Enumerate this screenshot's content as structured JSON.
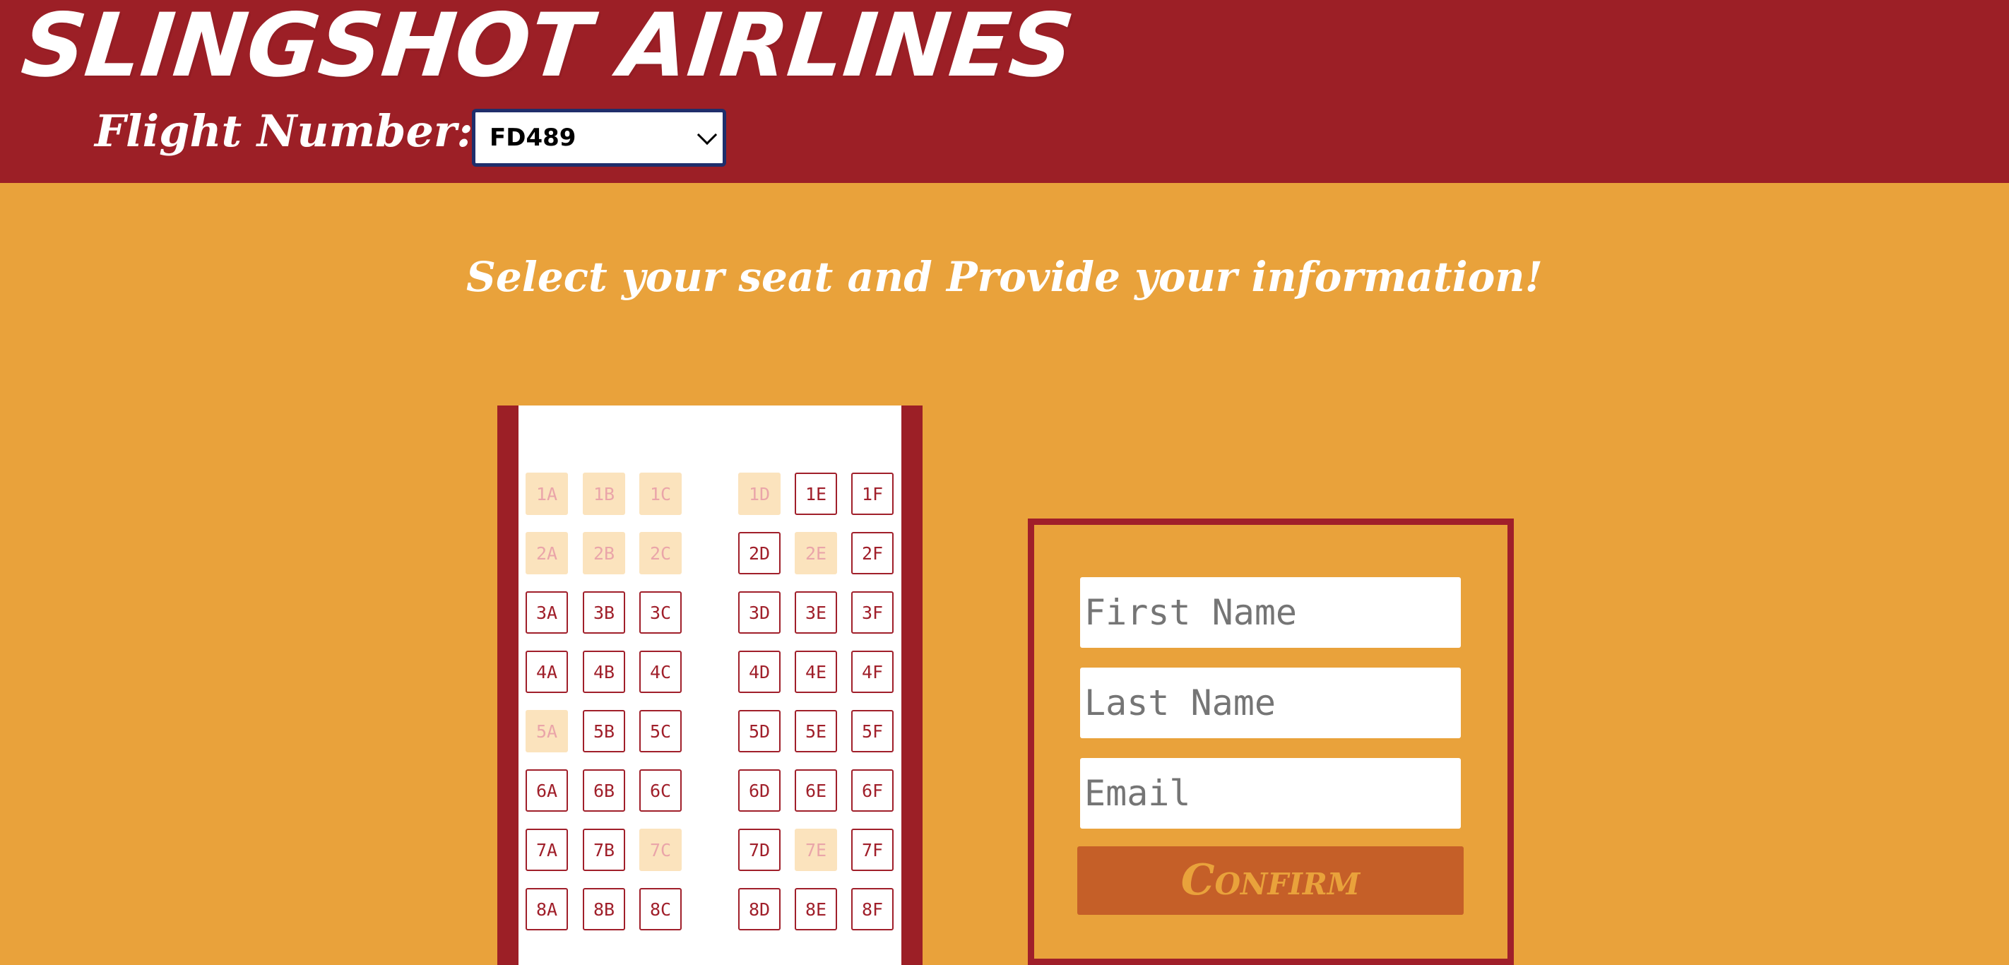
{
  "header": {
    "brand": "Slingshot Airlines",
    "flight_label": "Flight Number:",
    "flight_value": "FD489"
  },
  "prompt": "Select your seat and Provide your information!",
  "seats": [
    {
      "id": "1A",
      "taken": true
    },
    {
      "id": "1B",
      "taken": true
    },
    {
      "id": "1C",
      "taken": true
    },
    {
      "id": "1D",
      "taken": true
    },
    {
      "id": "1E",
      "taken": false
    },
    {
      "id": "1F",
      "taken": false
    },
    {
      "id": "2A",
      "taken": true
    },
    {
      "id": "2B",
      "taken": true
    },
    {
      "id": "2C",
      "taken": true
    },
    {
      "id": "2D",
      "taken": false
    },
    {
      "id": "2E",
      "taken": true
    },
    {
      "id": "2F",
      "taken": false
    },
    {
      "id": "3A",
      "taken": false
    },
    {
      "id": "3B",
      "taken": false
    },
    {
      "id": "3C",
      "taken": false
    },
    {
      "id": "3D",
      "taken": false
    },
    {
      "id": "3E",
      "taken": false
    },
    {
      "id": "3F",
      "taken": false
    },
    {
      "id": "4A",
      "taken": false
    },
    {
      "id": "4B",
      "taken": false
    },
    {
      "id": "4C",
      "taken": false
    },
    {
      "id": "4D",
      "taken": false
    },
    {
      "id": "4E",
      "taken": false
    },
    {
      "id": "4F",
      "taken": false
    },
    {
      "id": "5A",
      "taken": true
    },
    {
      "id": "5B",
      "taken": false
    },
    {
      "id": "5C",
      "taken": false
    },
    {
      "id": "5D",
      "taken": false
    },
    {
      "id": "5E",
      "taken": false
    },
    {
      "id": "5F",
      "taken": false
    },
    {
      "id": "6A",
      "taken": false
    },
    {
      "id": "6B",
      "taken": false
    },
    {
      "id": "6C",
      "taken": false
    },
    {
      "id": "6D",
      "taken": false
    },
    {
      "id": "6E",
      "taken": false
    },
    {
      "id": "6F",
      "taken": false
    },
    {
      "id": "7A",
      "taken": false
    },
    {
      "id": "7B",
      "taken": false
    },
    {
      "id": "7C",
      "taken": true
    },
    {
      "id": "7D",
      "taken": false
    },
    {
      "id": "7E",
      "taken": true
    },
    {
      "id": "7F",
      "taken": false
    },
    {
      "id": "8A",
      "taken": false
    },
    {
      "id": "8B",
      "taken": false
    },
    {
      "id": "8C",
      "taken": false
    },
    {
      "id": "8D",
      "taken": false
    },
    {
      "id": "8E",
      "taken": false
    },
    {
      "id": "8F",
      "taken": false
    }
  ],
  "form": {
    "first_name_placeholder": "First Name",
    "last_name_placeholder": "Last Name",
    "email_placeholder": "Email",
    "confirm_label": "Confirm"
  },
  "colors": {
    "header_bg": "#9c1f26",
    "page_bg": "#e9a23b",
    "seat_available_border": "#a01f2a",
    "seat_taken_bg": "#fbe3bd",
    "confirm_bg": "#c55f28"
  }
}
